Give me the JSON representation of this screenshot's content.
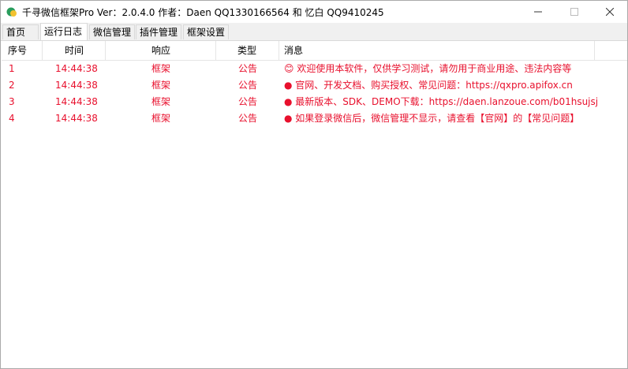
{
  "window": {
    "title": "千寻微信框架Pro Ver：2.0.4.0   作者：Daen QQ1330166564 和 忆白 QQ9410245"
  },
  "tabs": [
    {
      "label": "首页"
    },
    {
      "label": "运行日志"
    },
    {
      "label": "微信管理"
    },
    {
      "label": "插件管理"
    },
    {
      "label": "框架设置"
    }
  ],
  "columns": [
    "序号",
    "时间",
    "响应",
    "类型",
    "消息"
  ],
  "rows": [
    {
      "idx": "1",
      "time": "14:44:38",
      "resp": "框架",
      "type": "公告",
      "msg": "😊 欢迎使用本软件，仅供学习测试，请勿用于商业用途、违法内容等"
    },
    {
      "idx": "2",
      "time": "14:44:38",
      "resp": "框架",
      "type": "公告",
      "msg": "● 官网、开发文档、购买授权、常见问题：https://qxpro.apifox.cn"
    },
    {
      "idx": "3",
      "time": "14:44:38",
      "resp": "框架",
      "type": "公告",
      "msg": "● 最新版本、SDK、DEMO下载：https://daen.lanzoue.com/b01hsujsj"
    },
    {
      "idx": "4",
      "time": "14:44:38",
      "resp": "框架",
      "type": "公告",
      "msg": "● 如果登录微信后，微信管理不显示，请查看【官网】的【常见问题】"
    }
  ],
  "colors": {
    "row_text": "#e8102d"
  },
  "icons": {
    "app": "app-logo-icon",
    "min": "minimize-icon",
    "max": "maximize-icon",
    "close": "close-icon"
  }
}
